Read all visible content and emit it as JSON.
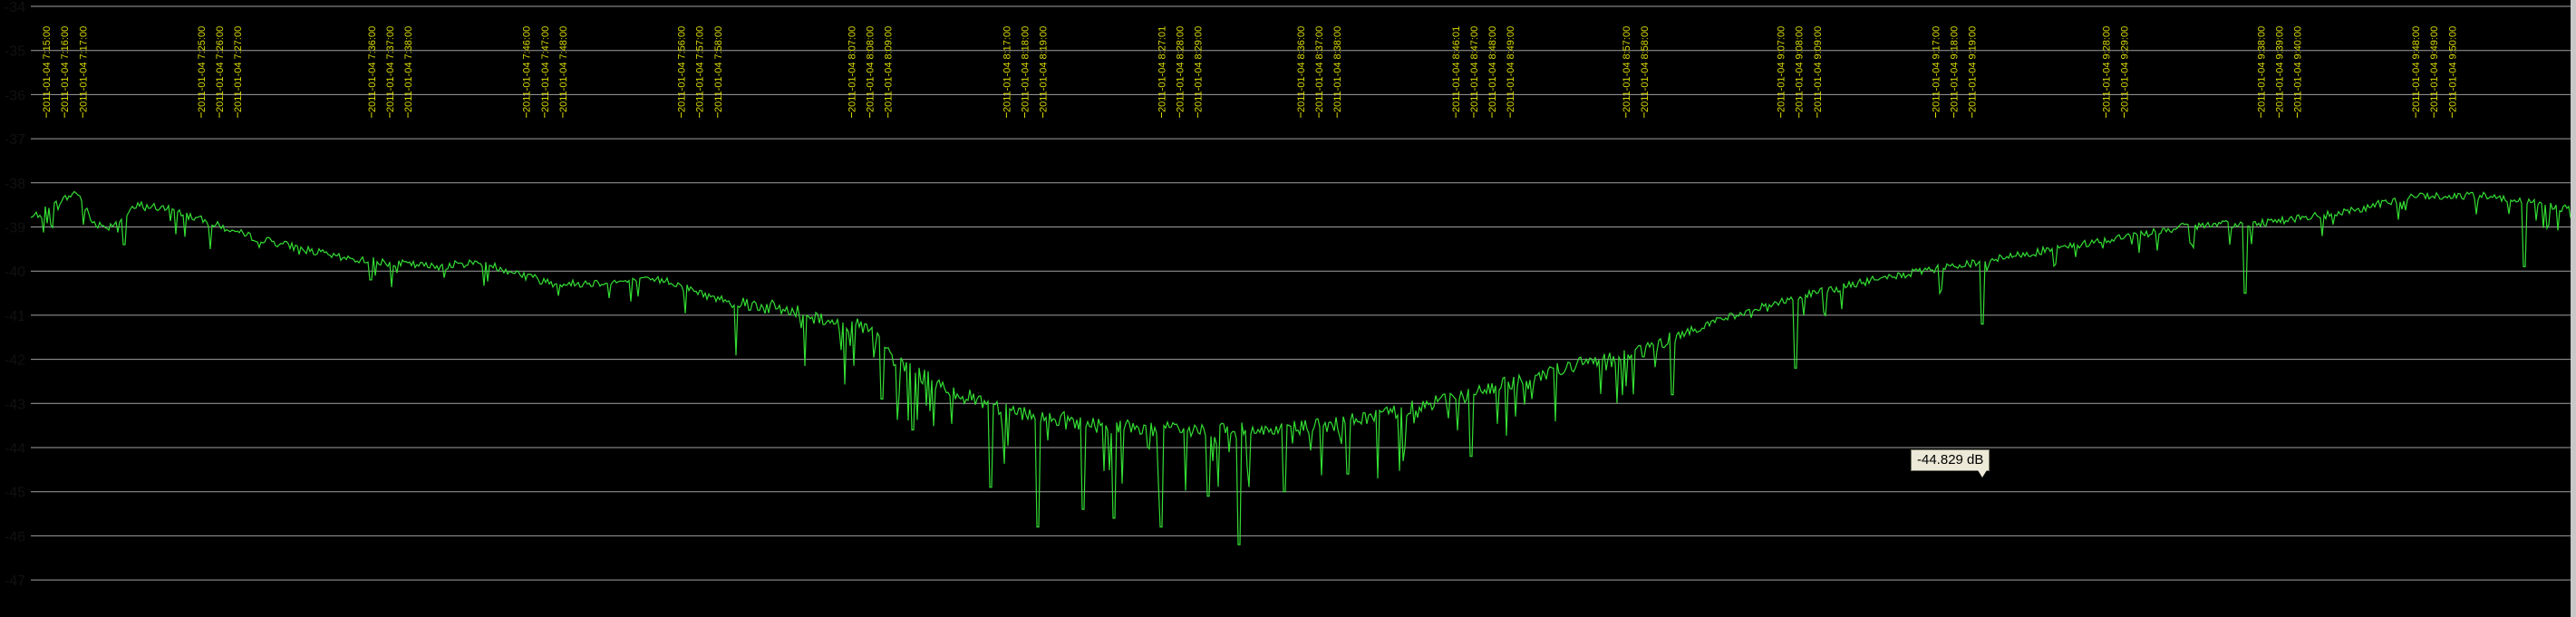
{
  "tooltip": {
    "text": "-44.829 dB"
  },
  "colors": {
    "background": "#000000",
    "grid": "#a0a0a0",
    "trace": "#33dd33",
    "timestamp": "#d8d800",
    "frame": "#c8c8c8"
  },
  "chart_data": {
    "type": "line",
    "title": "",
    "xlabel": "",
    "ylabel": "",
    "ylim": [
      -48,
      -34
    ],
    "y_ticks": [
      -34,
      -35,
      -36,
      -37,
      -38,
      -39,
      -40,
      -41,
      -42,
      -43,
      -44,
      -45,
      -46,
      -47
    ],
    "grid": true,
    "legend": "none",
    "x_range": [
      "2011-01-04 7:14:00",
      "2011-01-04 9:58:00"
    ],
    "timestamp_labels": [
      [
        "2011-01-04 7:15:00",
        "2011-01-04 7:16:00",
        "2011-01-04 7:17:00"
      ],
      [
        "2011-01-04 7:25:00",
        "2011-01-04 7:26:00",
        "2011-01-04 7:27:00"
      ],
      [
        "2011-01-04 7:36:00",
        "2011-01-04 7:37:00",
        "2011-01-04 7:38:00"
      ],
      [
        "2011-01-04 7:46:00",
        "2011-01-04 7:47:00",
        "2011-01-04 7:48:00"
      ],
      [
        "2011-01-04 7:56:00",
        "2011-01-04 7:57:00",
        "2011-01-04 7:58:00"
      ],
      [
        "2011-01-04 8:07:00",
        "2011-01-04 8:08:00",
        "2011-01-04 8:09:00"
      ],
      [
        "2011-01-04 8:17:00",
        "2011-01-04 8:18:00",
        "2011-01-04 8:19:00"
      ],
      [
        "2011-01-04 8:27:01",
        "2011-01-04 8:28:00",
        "2011-01-04 8:29:00"
      ],
      [
        "2011-01-04 8:36:00",
        "2011-01-04 8:37:00",
        "2011-01-04 8:38:00"
      ],
      [
        "2011-01-04 8:46:01",
        "2011-01-04 8:47:00",
        "2011-01-04 8:48:00",
        "2011-01-04 8:49:00"
      ],
      [
        "2011-01-04 8:57:00",
        "2011-01-04 8:58:00"
      ],
      [
        "2011-01-04 9:07:00",
        "2011-01-04 9:08:00",
        "2011-01-04 9:09:00"
      ],
      [
        "2011-01-04 9:17:00",
        "2011-01-04 9:18:00",
        "2011-01-04 9:19:00"
      ],
      [
        "2011-01-04 9:28:00",
        "2011-01-04 9:29:00"
      ],
      [
        "2011-01-04 9:38:00",
        "2011-01-04 9:39:00",
        "2011-01-04 9:40:00"
      ],
      [
        "2011-01-04 9:48:00",
        "2011-01-04 9:49:00",
        "2011-01-04 9:50:00"
      ]
    ],
    "series": [
      {
        "x": [
          "2011-01-04 7:14:00",
          "2011-01-04 7:17:00",
          "2011-01-04 7:18:00",
          "2011-01-04 7:19:00",
          "2011-01-04 7:21:00",
          "2011-01-04 7:23:00",
          "2011-01-04 7:28:00",
          "2011-01-04 7:34:00",
          "2011-01-04 7:40:00",
          "2011-01-04 7:43:00",
          "2011-01-04 7:48:00",
          "2011-01-04 7:55:00",
          "2011-01-04 7:58:00",
          "2011-01-04 8:03:00",
          "2011-01-04 8:08:00",
          "2011-01-04 8:10:00",
          "2011-01-04 8:14:00",
          "2011-01-04 8:18:00",
          "2011-01-04 8:23:00",
          "2011-01-04 8:28:00",
          "2011-01-04 8:33:00",
          "2011-01-04 8:38:00",
          "2011-01-04 8:43:00",
          "2011-01-04 8:48:00",
          "2011-01-04 8:53:00",
          "2011-01-04 8:58:00",
          "2011-01-04 9:03:00",
          "2011-01-04 9:08:00",
          "2011-01-04 9:13:00",
          "2011-01-04 9:18:00",
          "2011-01-04 9:23:00",
          "2011-01-04 9:28:00",
          "2011-01-04 9:33:00",
          "2011-01-04 9:38:00",
          "2011-01-04 9:43:00",
          "2011-01-04 9:48:00",
          "2011-01-04 9:53:00",
          "2011-01-04 9:58:00"
        ],
        "values": [
          -38.8,
          -38.2,
          -38.9,
          -39.0,
          -38.5,
          -38.6,
          -39.2,
          -39.7,
          -39.9,
          -39.8,
          -40.3,
          -40.2,
          -40.6,
          -40.9,
          -41.3,
          -42.1,
          -42.8,
          -43.2,
          -43.5,
          -43.6,
          -43.6,
          -43.5,
          -43.1,
          -42.7,
          -42.2,
          -41.8,
          -41.1,
          -40.6,
          -40.2,
          -39.9,
          -39.6,
          -39.3,
          -39.0,
          -38.9,
          -38.7,
          -38.3,
          -38.3,
          -38.6
        ]
      }
    ],
    "dips": [
      {
        "x": "2011-01-04 7:20:00",
        "value": -39.4
      },
      {
        "x": "2011-01-04 7:36:00",
        "value": -40.2
      },
      {
        "x": "2011-01-04 8:09:00",
        "value": -42.9
      },
      {
        "x": "2011-01-04 8:11:00",
        "value": -43.6
      },
      {
        "x": "2011-01-04 8:16:00",
        "value": -44.9
      },
      {
        "x": "2011-01-04 8:19:00",
        "value": -45.8
      },
      {
        "x": "2011-01-04 8:22:00",
        "value": -45.4
      },
      {
        "x": "2011-01-04 8:24:00",
        "value": -45.6
      },
      {
        "x": "2011-01-04 8:27:00",
        "value": -45.8
      },
      {
        "x": "2011-01-04 8:30:00",
        "value": -45.1
      },
      {
        "x": "2011-01-04 8:32:00",
        "value": -46.2
      },
      {
        "x": "2011-01-04 8:35:00",
        "value": -45.0
      },
      {
        "x": "2011-01-04 8:39:00",
        "value": -44.6
      },
      {
        "x": "2011-01-04 8:47:00",
        "value": -44.2
      },
      {
        "x": "2011-01-04 9:00:00",
        "value": -42.8
      },
      {
        "x": "2011-01-04 9:08:00",
        "value": -42.2
      },
      {
        "x": "2011-01-04 9:20:00",
        "value": -41.2
      },
      {
        "x": "2011-01-04 9:37:00",
        "value": -40.5
      },
      {
        "x": "2011-01-04 9:55:00",
        "value": -39.9
      }
    ]
  }
}
